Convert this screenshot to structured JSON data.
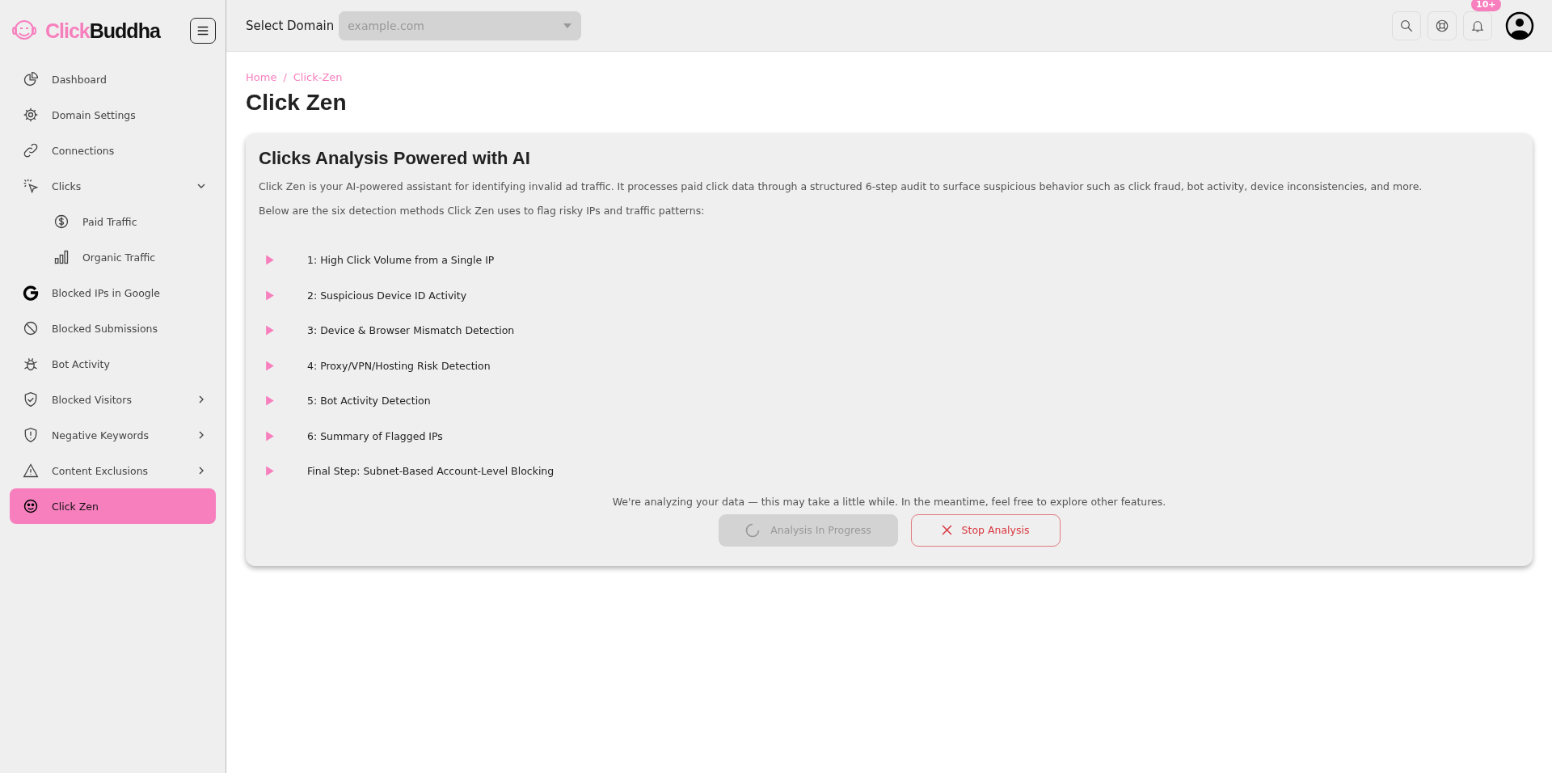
{
  "brand": {
    "part_1": "Click",
    "part_2": "Buddha"
  },
  "sidebar": {
    "items": [
      {
        "label": "Dashboard",
        "kind": "pie",
        "selected": false
      },
      {
        "label": "Domain Settings",
        "kind": "gear",
        "selected": false
      },
      {
        "label": "Connections",
        "kind": "link",
        "selected": false
      },
      {
        "label": "Clicks",
        "kind": "pointer",
        "selected": false,
        "expanded": true,
        "children": [
          {
            "label": "Paid Traffic",
            "kind": "dollar",
            "selected": false
          },
          {
            "label": "Organic Traffic",
            "kind": "bars",
            "selected": false
          }
        ]
      },
      {
        "label": "Blocked IPs in Google",
        "kind": "google",
        "selected": false
      },
      {
        "label": "Blocked Submissions",
        "kind": "ban",
        "selected": false
      },
      {
        "label": "Bot Activity",
        "kind": "bug",
        "selected": false
      },
      {
        "label": "Blocked Visitors",
        "kind": "shield-check",
        "selected": false,
        "expanded": false
      },
      {
        "label": "Negative Keywords",
        "kind": "shield-alert",
        "selected": false,
        "expanded": false
      },
      {
        "label": "Content Exclusions",
        "kind": "warning",
        "selected": false,
        "expanded": false
      },
      {
        "label": "Click Zen",
        "kind": "face",
        "selected": true
      }
    ]
  },
  "topbar": {
    "domain_label": "Select Domain",
    "domain_select": {
      "placeholder": "example.com",
      "disabled": true
    },
    "notification_badge": "10+"
  },
  "breadcrumb": {
    "items": [
      "Home",
      "Click-Zen"
    ],
    "separator": "/"
  },
  "page_title": "Click Zen",
  "card": {
    "title": "Clicks Analysis Powered with AI",
    "description": "Click Zen is your AI-powered assistant for identifying invalid ad traffic. It processes paid click data through a structured 6-step audit to surface suspicious behavior such as click fraud, bot activity, device inconsistencies, and more.",
    "intro": "Below are the six detection methods Click Zen uses to flag risky IPs and traffic patterns:",
    "steps": [
      {
        "label": "1: High Click Volume from a Single IP",
        "expanded": false
      },
      {
        "label": "2: Suspicious Device ID Activity",
        "expanded": false
      },
      {
        "label": "3: Device & Browser Mismatch Detection",
        "expanded": false
      },
      {
        "label": "4: Proxy/VPN/Hosting Risk Detection",
        "expanded": false
      },
      {
        "label": "5: Bot Activity Detection",
        "expanded": false
      },
      {
        "label": "6: Summary of Flagged IPs",
        "expanded": false
      },
      {
        "label": "Final Step: Subnet-Based Account-Level Blocking",
        "expanded": false
      }
    ],
    "status_note": "We're analyzing your data — this may take a little while. In the meantime, feel free to explore other features.",
    "progress_button": {
      "label": "Analysis In Progress",
      "disabled": true
    },
    "stop_button": {
      "label": "Stop Analysis"
    }
  }
}
